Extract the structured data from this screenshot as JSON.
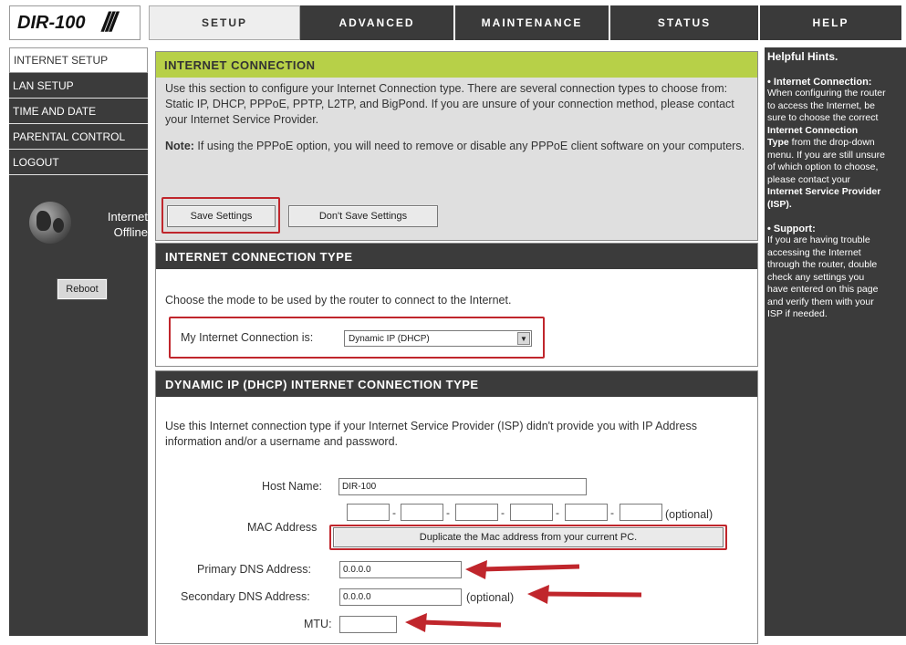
{
  "header": {
    "logo": "DIR-100",
    "logo_mark": "///",
    "tabs": [
      {
        "label": "SETUP"
      },
      {
        "label": "ADVANCED"
      },
      {
        "label": "MAINTENANCE"
      },
      {
        "label": "STATUS"
      },
      {
        "label": "HELP"
      }
    ]
  },
  "sidebar": {
    "items": [
      {
        "label": "INTERNET SETUP"
      },
      {
        "label": "LAN SETUP"
      },
      {
        "label": "TIME AND DATE"
      },
      {
        "label": "PARENTAL CONTROL"
      },
      {
        "label": "LOGOUT"
      }
    ],
    "status_line1": "Internet",
    "status_line2": "Offline",
    "reboot_label": "Reboot"
  },
  "internet_connection": {
    "heading": "INTERNET CONNECTION",
    "description": "Use this section to configure your Internet Connection type. There are several connection types to choose from: Static IP, DHCP, PPPoE, PPTP, L2TP, and BigPond. If you are unsure of your connection method, please contact your Internet Service Provider.",
    "note_label": "Note:",
    "note_text": " If using the PPPoE option, you will need to remove or disable any PPPoE client software on your computers.",
    "save_label": "Save Settings",
    "dont_save_label": "Don't Save Settings"
  },
  "connection_type": {
    "heading": "INTERNET CONNECTION TYPE",
    "description": "Choose the mode to be used by the router to connect to the Internet.",
    "select_label": "My Internet Connection is:",
    "select_value": "Dynamic IP (DHCP)"
  },
  "dhcp": {
    "heading": "DYNAMIC IP (DHCP) INTERNET CONNECTION TYPE",
    "description": "Use this Internet connection type if your Internet Service Provider (ISP) didn't provide you with IP Address information and/or a username and password.",
    "host_name_label": "Host Name:",
    "host_name_value": "DIR-100",
    "mac_label": "MAC Address",
    "mac_optional": "(optional)",
    "mac_dash": "-",
    "duplicate_label": "Duplicate the Mac address from your current PC.",
    "primary_dns_label": "Primary DNS Address:",
    "primary_dns_value": "0.0.0.0",
    "secondary_dns_label": "Secondary DNS Address:",
    "secondary_dns_value": "0.0.0.0",
    "secondary_optional": "(optional)",
    "mtu_label": "MTU:",
    "mtu_value": ""
  },
  "hints": {
    "title": "Helpful Hints.",
    "h1": "•  Internet Connection:",
    "b1_line1": "When configuring the router",
    "b1_line2": "to access the Internet, be",
    "b1_line3": "sure to choose the correct",
    "b1_strong1": "Internet Connection",
    "b1_strong2": "Type",
    "b1_line5": " from the drop-down",
    "b1_line6": "menu. If you are still unsure",
    "b1_line7": "of which option to choose,",
    "b1_line8": "please contact your",
    "b1_strong3": "Internet Service Provider",
    "b1_strong4": "(ISP).",
    "h2": "•  Support:",
    "b2_line1": "If you are having trouble",
    "b2_line2": "accessing the Internet",
    "b2_line3": "through the router, double",
    "b2_line4": "check any settings you",
    "b2_line5": "have entered on this page",
    "b2_line6": "and verify them with your",
    "b2_line7": "ISP if needed."
  },
  "colors": {
    "accent_green": "#b7d048",
    "dark_panel": "#3b3b3b",
    "highlight_red": "#c0262c"
  }
}
